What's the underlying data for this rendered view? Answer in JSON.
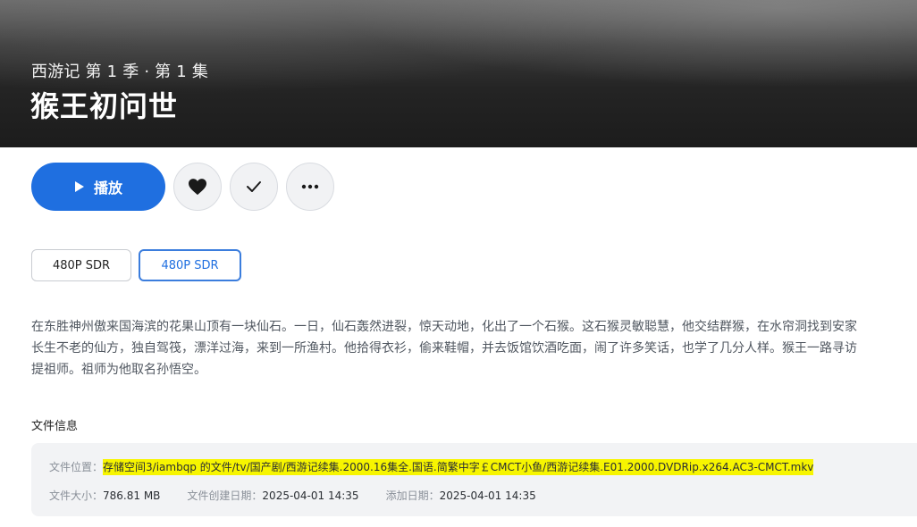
{
  "hero": {
    "subtitle": "西游记 第 1 季 · 第 1 集",
    "title": "猴王初问世"
  },
  "actions": {
    "play_label": "播放"
  },
  "quality": {
    "options": [
      "480P SDR",
      "480P SDR"
    ],
    "selected_index": 1
  },
  "description": {
    "text": "在东胜神州傲来国海滨的花果山顶有一块仙石。一日，仙石轰然进裂，惊天动地，化出了一个石猴。这石猴灵敏聪慧，他交结群猴，在水帘洞找到安家\n长生不老的仙方，独自驾筏，漂洋过海，来到一所渔村。他拾得衣衫，偷来鞋帽，并去饭馆饮酒吃面，闹了许多笑话，也学了几分人样。猴王一路寻访\n提祖师。祖师为他取名孙悟空。"
  },
  "file_info": {
    "heading": "文件信息",
    "location_label": "文件位置：",
    "location_value": "存储空间3/iambqp 的文件/tv/国产剧/西游记续集.2000.16集全.国语.简繁中字￡CMCT小鱼/西游记续集.E01.2000.DVDRip.x264.AC3-CMCT.mkv",
    "size_label": "文件大小：",
    "size_value": "786.81 MB",
    "created_label": "文件创建日期：",
    "created_value": "2025-04-01 14:35",
    "added_label": "添加日期：",
    "added_value": "2025-04-01 14:35"
  },
  "colors": {
    "accent": "#1f6fe0",
    "highlight": "#f7f500"
  },
  "icons": [
    "play-icon",
    "heart-icon",
    "check-icon",
    "more-icon"
  ]
}
